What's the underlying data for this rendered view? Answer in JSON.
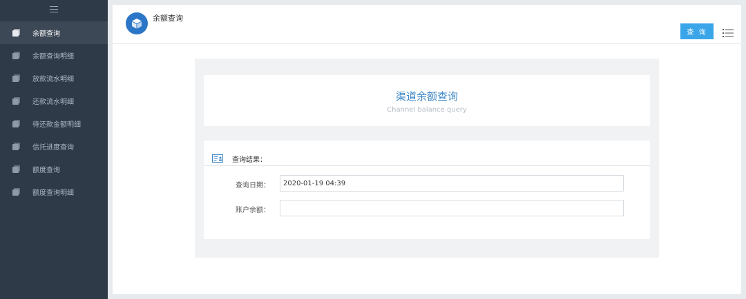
{
  "sidebar": {
    "items": [
      {
        "label": "余额查询",
        "active": true
      },
      {
        "label": "余额查询明细",
        "active": false
      },
      {
        "label": "放款流水明细",
        "active": false
      },
      {
        "label": "还款流水明细",
        "active": false
      },
      {
        "label": "待还款金额明细",
        "active": false
      },
      {
        "label": "信托进度查询",
        "active": false
      },
      {
        "label": "额度查询",
        "active": false
      },
      {
        "label": "额度查询明细",
        "active": false
      }
    ]
  },
  "header": {
    "title": "余额查询",
    "query_label": "查 询"
  },
  "card": {
    "title": "渠道余额查询",
    "subtitle": "Channel balance query"
  },
  "result": {
    "heading": "查询结果：",
    "fields": [
      {
        "label": "查询日期：",
        "value": "2020-01-19 04:39"
      },
      {
        "label": "账户余额：",
        "value": ""
      }
    ]
  },
  "colors": {
    "sidebar_bg": "#2e3a48",
    "accent": "#3aa5e8",
    "title_blue": "#3c87c6"
  }
}
